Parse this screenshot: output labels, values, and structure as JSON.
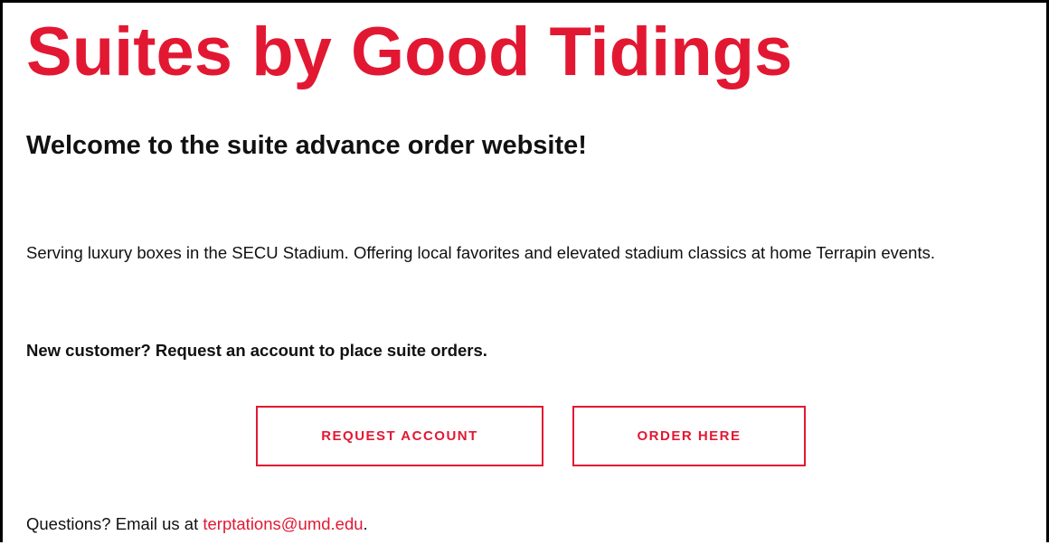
{
  "colors": {
    "brand_red": "#e21833",
    "text": "#111111",
    "background": "#ffffff"
  },
  "header": {
    "title": "Suites by Good Tidings"
  },
  "main": {
    "welcome": "Welcome to the suite advance order website!",
    "intro": "Serving luxury boxes in the SECU Stadium. Offering local favorites and elevated stadium classics at home Terrapin events.",
    "new_customer": "New customer? Request an account to place suite orders.",
    "buttons": {
      "request_account": "REQUEST ACCOUNT",
      "order_here": "ORDER HERE"
    }
  },
  "footer": {
    "questions_prefix": "Questions? Email us at ",
    "email": "terptations@umd.edu",
    "questions_suffix": "."
  }
}
